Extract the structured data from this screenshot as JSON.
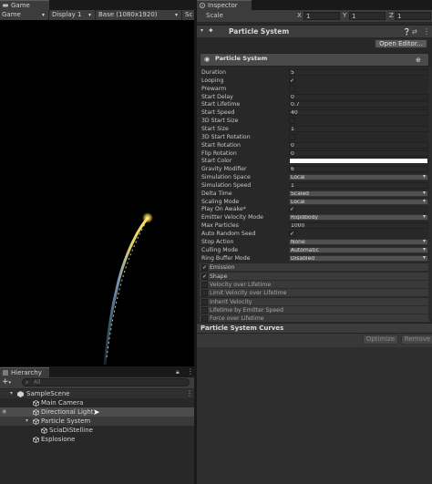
{
  "game": {
    "tab_label": "Game",
    "display_mode": "Game",
    "display": "Display 1",
    "resolution": "Base (1080x1920)",
    "scale_cut": "Sc"
  },
  "hierarchy": {
    "tab_label": "Hierarchy",
    "add_label": "+",
    "search_placeholder": "All",
    "scene": "SampleScene",
    "items": [
      {
        "label": "Main Camera"
      },
      {
        "label": "Directional Light"
      },
      {
        "label": "Particle System"
      },
      {
        "label": "SciaDiStelline"
      },
      {
        "label": "Esplosione"
      }
    ]
  },
  "inspector": {
    "tab_label": "Inspector",
    "scale_label": "Scale",
    "scale": {
      "x_label": "X",
      "x": "1",
      "y_label": "Y",
      "y": "1",
      "z_label": "Z",
      "z": "1"
    },
    "component_title": "Particle System",
    "open_editor_label": "Open Editor...",
    "module_title": "Particle System",
    "properties": [
      {
        "label": "Duration",
        "type": "text",
        "value": "5"
      },
      {
        "label": "Looping",
        "type": "check",
        "checked": true
      },
      {
        "label": "Prewarm",
        "type": "check",
        "checked": false
      },
      {
        "label": "Start Delay",
        "type": "text",
        "value": "0"
      },
      {
        "label": "Start Lifetime",
        "type": "text",
        "value": "0.7"
      },
      {
        "label": "Start Speed",
        "type": "text",
        "value": "40"
      },
      {
        "label": "3D Start Size",
        "type": "check",
        "checked": false
      },
      {
        "label": "Start Size",
        "type": "text",
        "value": "1"
      },
      {
        "label": "3D Start Rotation",
        "type": "check",
        "checked": false
      },
      {
        "label": "Start Rotation",
        "type": "text",
        "value": "0"
      },
      {
        "label": "Flip Rotation",
        "type": "text",
        "value": "0"
      },
      {
        "label": "Start Color",
        "type": "color",
        "value": "#ffffff"
      },
      {
        "label": "Gravity Modifier",
        "type": "text",
        "value": "6"
      },
      {
        "label": "Simulation Space",
        "type": "dropdown",
        "value": "Local"
      },
      {
        "label": "Simulation Speed",
        "type": "text",
        "value": "1"
      },
      {
        "label": "Delta Time",
        "type": "dropdown",
        "value": "Scaled"
      },
      {
        "label": "Scaling Mode",
        "type": "dropdown",
        "value": "Local"
      },
      {
        "label": "Play On Awake*",
        "type": "check",
        "checked": true
      },
      {
        "label": "Emitter Velocity Mode",
        "type": "dropdown",
        "value": "Rigidbody"
      },
      {
        "label": "Max Particles",
        "type": "text",
        "value": "1000"
      },
      {
        "label": "Auto Random Seed",
        "type": "check",
        "checked": true
      },
      {
        "label": "Stop Action",
        "type": "dropdown",
        "value": "None"
      },
      {
        "label": "Culling Mode",
        "type": "dropdown",
        "value": "Automatic"
      },
      {
        "label": "Ring Buffer Mode",
        "type": "dropdown",
        "value": "Disabled"
      }
    ],
    "modules": [
      {
        "label": "Emission",
        "checked": true
      },
      {
        "label": "Shape",
        "checked": true
      },
      {
        "label": "Velocity over Lifetime",
        "checked": false
      },
      {
        "label": "Limit Velocity over Lifetime",
        "checked": false
      },
      {
        "label": "Inherit Velocity",
        "checked": false
      },
      {
        "label": "Lifetime by Emitter Speed",
        "checked": false
      },
      {
        "label": "Force over Lifetime",
        "checked": false
      }
    ],
    "curves_title": "Particle System Curves",
    "optimize_label": "Optimize",
    "remove_label": "Remove"
  },
  "colors": {
    "accent": "#3a79bb",
    "particle_core": "#ffe066",
    "particle_trail": "#8fd0ff"
  }
}
